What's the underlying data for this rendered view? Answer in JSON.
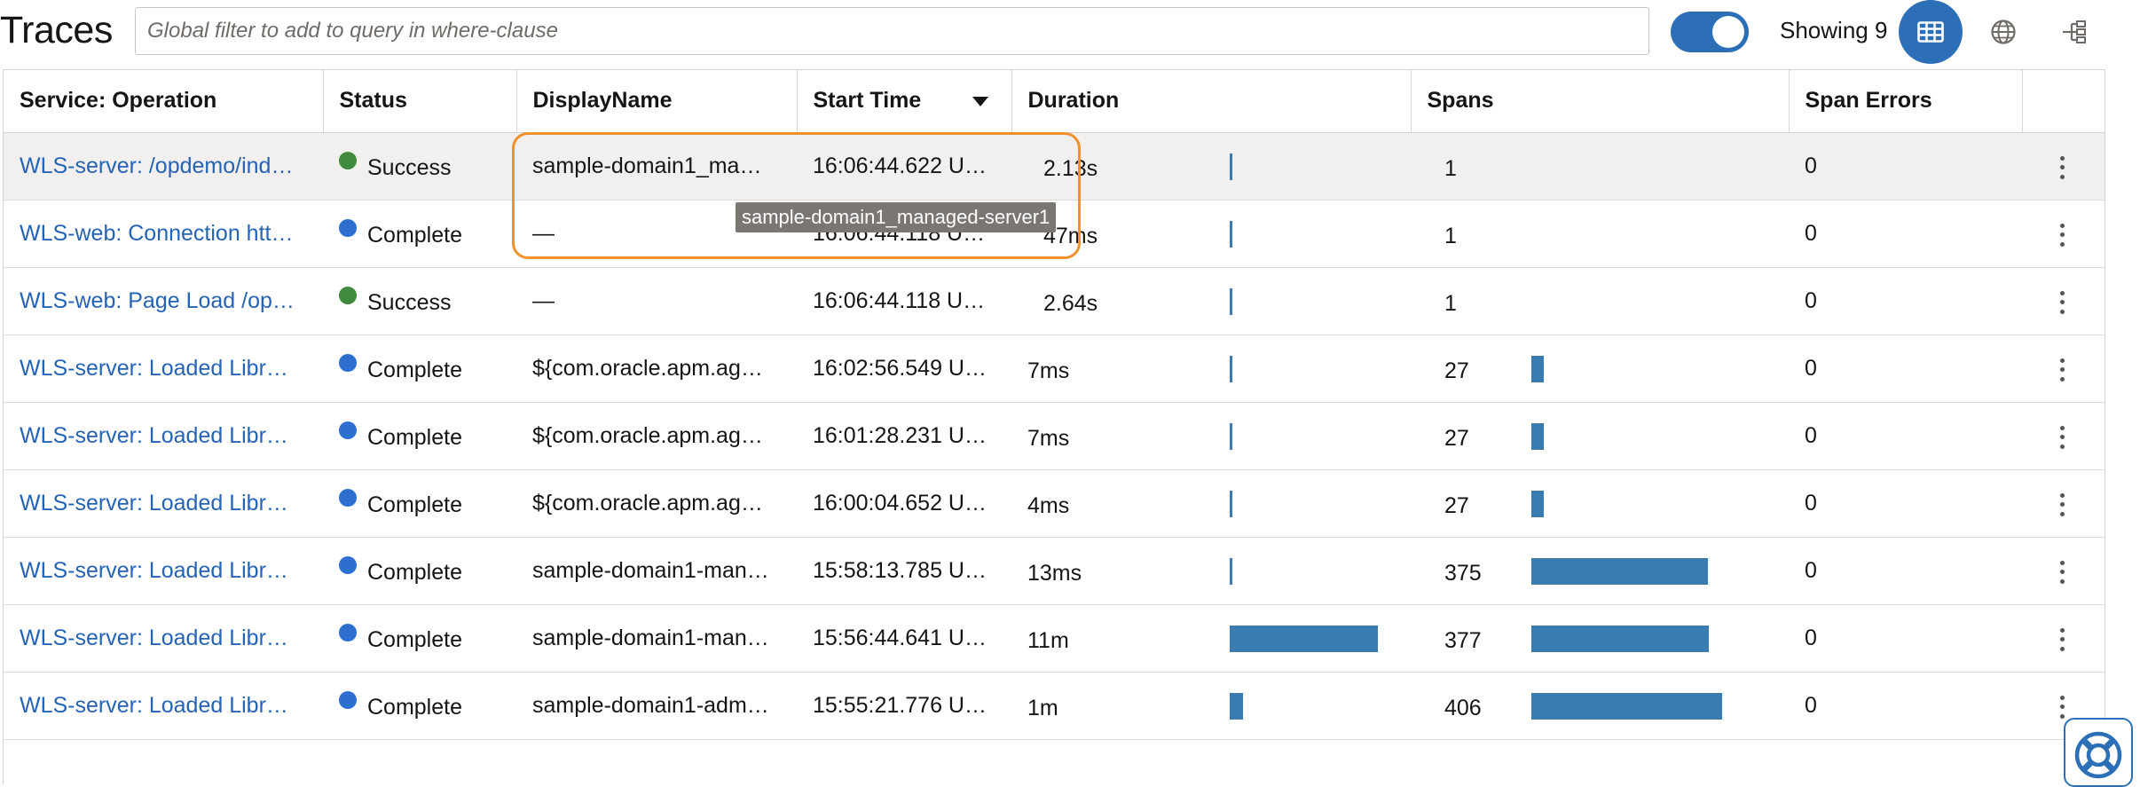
{
  "header": {
    "title": "Traces",
    "filter_placeholder": "Global filter to add to query in where-clause",
    "filter_value": "",
    "toggle_on": true,
    "showing_label": "Showing 9",
    "views": [
      {
        "name": "table-view",
        "icon": "table-icon",
        "active": true
      },
      {
        "name": "map-view",
        "icon": "globe-icon",
        "active": false
      },
      {
        "name": "topology-view",
        "icon": "topology-icon",
        "active": false
      }
    ]
  },
  "table": {
    "columns": [
      "Service: Operation",
      "Status",
      "DisplayName",
      "Start Time",
      "Duration",
      "Spans",
      "Span Errors",
      ""
    ],
    "sort_column": "Start Time",
    "sort_direction": "descending",
    "duration_max_ms": 660000,
    "spans_max": 406,
    "rows": [
      {
        "operation": "WLS-server: /opdemo/ind…",
        "status": "Success",
        "status_color": "#3f8a3b",
        "display_name": "sample-domain1_ma…",
        "start_time": "16:06:44.622 U…",
        "duration": "2.13s",
        "duration_ms": 2130,
        "spans": "1",
        "spans_n": 1,
        "span_errors": "0"
      },
      {
        "operation": "WLS-web: Connection htt…",
        "status": "Complete",
        "status_color": "#2c6fd1",
        "display_name": "—",
        "start_time": "16:06:44.118 U…",
        "duration": "47ms",
        "duration_ms": 47,
        "spans": "1",
        "spans_n": 1,
        "span_errors": "0"
      },
      {
        "operation": "WLS-web: Page Load /op…",
        "status": "Success",
        "status_color": "#3f8a3b",
        "display_name": "—",
        "start_time": "16:06:44.118 U…",
        "duration": "2.64s",
        "duration_ms": 2640,
        "spans": "1",
        "spans_n": 1,
        "span_errors": "0"
      },
      {
        "operation": "WLS-server: Loaded Libr…",
        "status": "Complete",
        "status_color": "#2c6fd1",
        "display_name": "${com.oracle.apm.ag…",
        "start_time": "16:02:56.549 U…",
        "duration": "7ms",
        "duration_ms": 7,
        "spans": "27",
        "spans_n": 27,
        "span_errors": "0"
      },
      {
        "operation": "WLS-server: Loaded Libr…",
        "status": "Complete",
        "status_color": "#2c6fd1",
        "display_name": "${com.oracle.apm.ag…",
        "start_time": "16:01:28.231 U…",
        "duration": "7ms",
        "duration_ms": 7,
        "spans": "27",
        "spans_n": 27,
        "span_errors": "0"
      },
      {
        "operation": "WLS-server: Loaded Libr…",
        "status": "Complete",
        "status_color": "#2c6fd1",
        "display_name": "${com.oracle.apm.ag…",
        "start_time": "16:00:04.652 U…",
        "duration": "4ms",
        "duration_ms": 4,
        "spans": "27",
        "spans_n": 27,
        "span_errors": "0"
      },
      {
        "operation": "WLS-server: Loaded Libr…",
        "status": "Complete",
        "status_color": "#2c6fd1",
        "display_name": "sample-domain1-man…",
        "start_time": "15:58:13.785 U…",
        "duration": "13ms",
        "duration_ms": 13,
        "spans": "375",
        "spans_n": 375,
        "span_errors": "0"
      },
      {
        "operation": "WLS-server: Loaded Libr…",
        "status": "Complete",
        "status_color": "#2c6fd1",
        "display_name": "sample-domain1-man…",
        "start_time": "15:56:44.641 U…",
        "duration": "11m",
        "duration_ms": 660000,
        "spans": "377",
        "spans_n": 377,
        "span_errors": "0"
      },
      {
        "operation": "WLS-server: Loaded Libr…",
        "status": "Complete",
        "status_color": "#2c6fd1",
        "display_name": "sample-domain1-adm…",
        "start_time": "15:55:21.776 U…",
        "duration": "1m",
        "duration_ms": 60000,
        "spans": "406",
        "spans_n": 406,
        "span_errors": "0"
      }
    ]
  },
  "tooltip": {
    "text": "sample-domain1_managed-server1"
  },
  "colors": {
    "accent": "#2c6fb7",
    "link": "#2563b7",
    "bar": "#3a7bb0",
    "highlight": "#f0912c"
  },
  "help": {
    "icon": "lifebuoy-icon"
  }
}
